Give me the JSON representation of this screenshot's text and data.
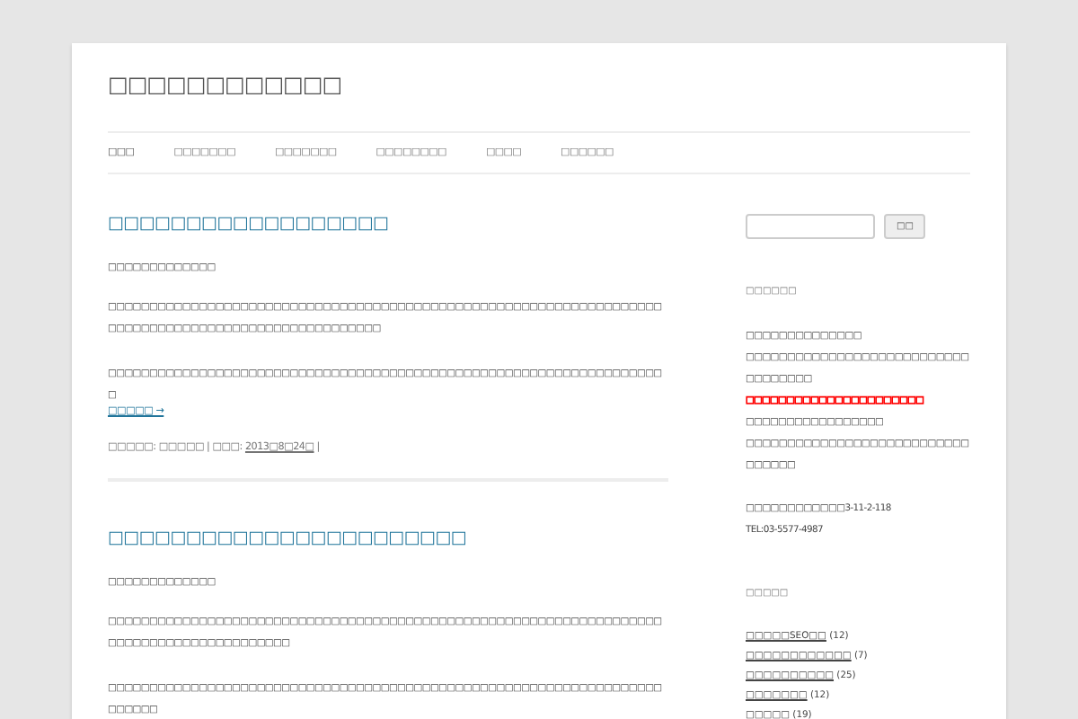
{
  "site_title": "□□□□□□□□□□□□",
  "nav": [
    {
      "label": "□□□",
      "selected": true
    },
    {
      "label": "□□□□□□□",
      "selected": false
    },
    {
      "label": "□□□□□□□",
      "selected": false
    },
    {
      "label": "□□□□□□□□",
      "selected": false
    },
    {
      "label": "□□□□",
      "selected": false
    },
    {
      "label": "□□□□□□",
      "selected": false
    }
  ],
  "posts": [
    {
      "title": "□□□□□□□□□□□□□□□□□□",
      "subtitle": "□□□□□□□□□□□□□",
      "paragraphs": [
        "□□□□□□□□□□□□□□□□□□□□□□□□□□□□□□□□□□□□□□□□□□□□□□□□□□□□□□□□□□□□□□□□□□□□□□□□□□□□□□□□□□□□□□□□□□□□□□□□□□□□",
        "□□□□□□□□□□□□□□□□□□□□□□□□□□□□□□□□□□□□□□□□□□□□□□□□□□□□□□□□□□□□□□□□□□□□"
      ],
      "more": "□□□□□ →",
      "meta_label": "□□□□□: □□□□□ | □□□: ",
      "date": "2013□8□24□",
      "meta_end": " |"
    },
    {
      "title": "□□□□□□□□□□□□□□□□□□□□□□□",
      "subtitle": "□□□□□□□□□□□□□",
      "paragraphs": [
        "□□□□□□□□□□□□□□□□□□□□□□□□□□□□□□□□□□□□□□□□□□□□□□□□□□□□□□□□□□□□□□□□□□□□□□□□□□□□□□□□□□□□□□□□□",
        "□□□□□□□□□□□□□□□□□□□□□□□□□□□□□□□□□□□□□□□□□□□□□□□□□□□□□□□□□□□□□□□□□□□□□□□□□"
      ]
    }
  ],
  "sidebar": {
    "search_button": "□□",
    "widgets": [
      {
        "kind": "text",
        "title": "□□□□□□",
        "lines": [
          {
            "text": "□□□□□□□□□□□□□□"
          },
          {
            "text": "□□□□□□□□□□□□□□□□□□□□□□□□□□□□□□□□□□□"
          },
          {
            "parts": [
              {
                "text": "□□□□□□□□□□□□□□□□□□□□□□",
                "color": "#ff0000"
              },
              {
                "text": "□□□□□□□□□□□□"
              },
              {
                "text": "□□□□□"
              }
            ]
          },
          {
            "text": "□□□□□□□□□□□□□□□□□□□□□□□□□□□□□□□□□"
          }
        ],
        "address": [
          "□□□□□□□□□□□□3-11-2-118",
          "TEL:03-5577-4987"
        ]
      },
      {
        "kind": "list",
        "title": "□□□□□",
        "items": [
          {
            "label": "□□□□□SEO□□",
            "count": "(12)"
          },
          {
            "label": "□□□□□□□□□□□□",
            "count": "(7)"
          },
          {
            "label": "□□□□□□□□□□",
            "count": "(25)"
          },
          {
            "label": "□□□□□□□",
            "count": "(12)"
          },
          {
            "label": "□□□□□",
            "count": "(19)"
          }
        ]
      }
    ]
  }
}
